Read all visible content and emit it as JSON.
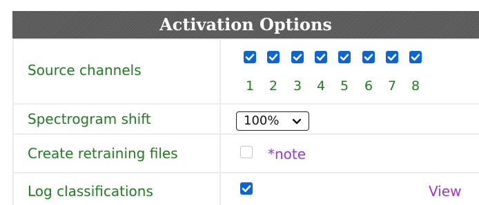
{
  "header": {
    "title": "Activation Options"
  },
  "rows": {
    "source_channels": {
      "label": "Source channels",
      "channels": [
        {
          "number": "1",
          "checked": true
        },
        {
          "number": "2",
          "checked": true
        },
        {
          "number": "3",
          "checked": true
        },
        {
          "number": "4",
          "checked": true
        },
        {
          "number": "5",
          "checked": true
        },
        {
          "number": "6",
          "checked": true
        },
        {
          "number": "7",
          "checked": true
        },
        {
          "number": "8",
          "checked": true
        }
      ]
    },
    "spectrogram_shift": {
      "label": "Spectrogram shift",
      "selected": "100%"
    },
    "retraining": {
      "label": "Create retraining files",
      "checked": false,
      "note": "*note"
    },
    "log": {
      "label": "Log classifications",
      "checked": true,
      "view_link": "View"
    }
  },
  "colors": {
    "label_green": "#1e7e1e",
    "checkbox_blue": "#0a66d8",
    "link_purple": "#9b35d6",
    "header_gray": "#5e5e5e"
  }
}
